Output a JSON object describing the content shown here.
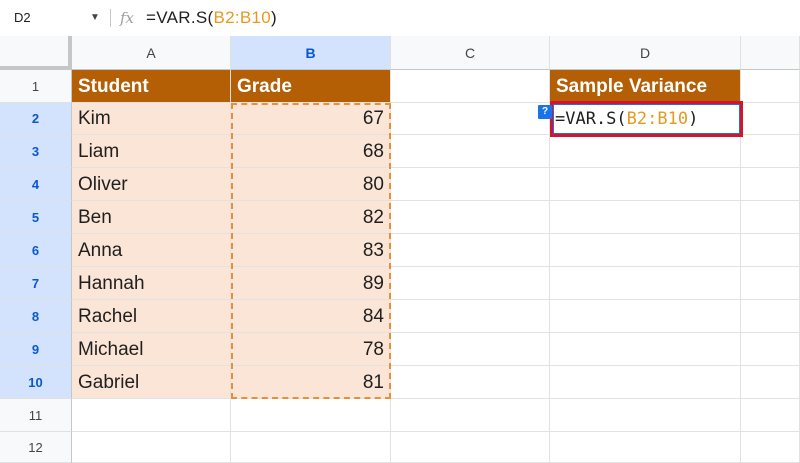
{
  "formula_bar": {
    "cell_ref": "D2",
    "caret_icon": "dropdown-caret-icon",
    "fx_icon": "fx",
    "formula_prefix": "=VAR.S(",
    "formula_range": "B2:B10",
    "formula_suffix": ")"
  },
  "columns": [
    "A",
    "B",
    "C",
    "D"
  ],
  "selected_column": "B",
  "rows": [
    "1",
    "2",
    "3",
    "4",
    "5",
    "6",
    "7",
    "8",
    "9",
    "10",
    "11",
    "12"
  ],
  "table": {
    "header_student": "Student",
    "header_grade": "Grade",
    "records": [
      {
        "student": "Kim",
        "grade": "67"
      },
      {
        "student": "Liam",
        "grade": "68"
      },
      {
        "student": "Oliver",
        "grade": "80"
      },
      {
        "student": "Ben",
        "grade": "82"
      },
      {
        "student": "Anna",
        "grade": "83"
      },
      {
        "student": "Hannah",
        "grade": "89"
      },
      {
        "student": "Rachel",
        "grade": "84"
      },
      {
        "student": "Michael",
        "grade": "78"
      },
      {
        "student": "Gabriel",
        "grade": "81"
      }
    ]
  },
  "result": {
    "header": "Sample Variance",
    "edit_prefix": "=VAR.S(",
    "edit_range": "B2:B10",
    "edit_suffix": ")",
    "help_badge": "?"
  },
  "colors": {
    "header_fill": "#b45f06",
    "data_fill": "#fbe5d6",
    "range_ref": "#e69a1e",
    "highlight_border": "#d3142c",
    "selection_header": "#d3e3fd"
  }
}
